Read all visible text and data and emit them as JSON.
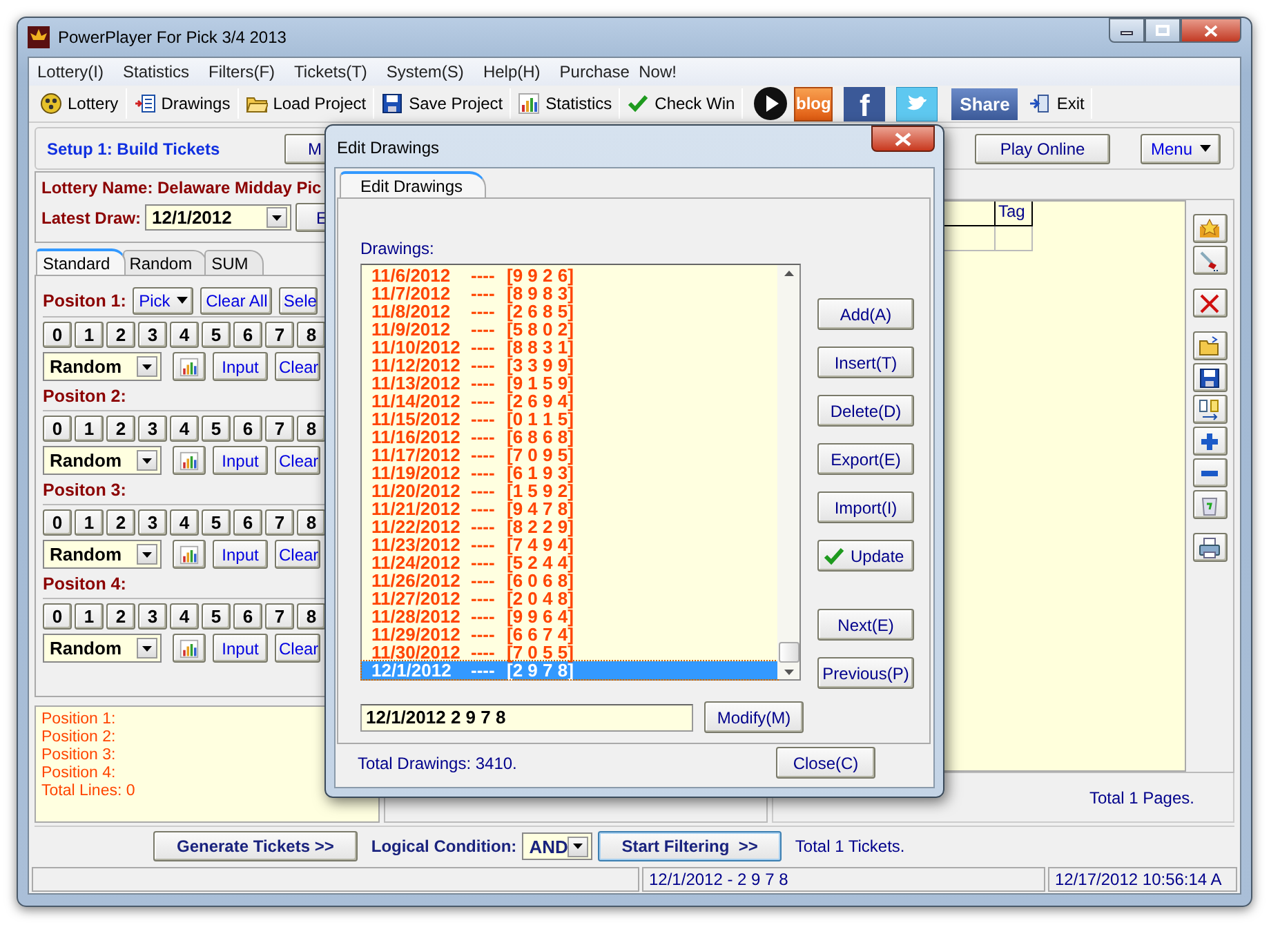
{
  "window": {
    "title": "PowerPlayer For Pick 3/4 2013"
  },
  "menu": [
    "Lottery(I)",
    "Statistics",
    "Filters(F)",
    "Tickets(T)",
    "System(S)",
    "Help(H)",
    "Purchase  Now!"
  ],
  "toolbar": [
    {
      "kind": "tool",
      "label": "Lottery"
    },
    {
      "kind": "tool",
      "label": "Drawings"
    },
    {
      "kind": "tool",
      "label": "Load Project"
    },
    {
      "kind": "tool",
      "label": "Save Project"
    },
    {
      "kind": "tool",
      "label": "Statistics"
    },
    {
      "kind": "tool",
      "label": "Check Win"
    },
    {
      "kind": "play"
    },
    {
      "kind": "blog",
      "label": "blog"
    },
    {
      "kind": "facebook",
      "label": "f"
    },
    {
      "kind": "twitter"
    },
    {
      "kind": "share",
      "label": "Share"
    },
    {
      "kind": "tool",
      "label": "Exit"
    }
  ],
  "setup": {
    "title": "Setup 1: Build  Tickets",
    "cut_button": "M",
    "play_online": "Play Online",
    "menu": "Menu"
  },
  "lottery": {
    "name": "Lottery  Name: Delaware Midday Pic",
    "latest_label": "Latest Draw:",
    "latest_value": "12/1/2012",
    "cut_button": "E"
  },
  "tabs": [
    {
      "label": "Standard",
      "selected": true
    },
    {
      "label": "Random",
      "selected": false
    },
    {
      "label": "SUM",
      "selected": false
    }
  ],
  "position_tools": {
    "pick": "Pick",
    "clear_all": "Clear All",
    "select": "Sele"
  },
  "positions": [
    {
      "title": "Positon 1:",
      "digits": [
        "0",
        "1",
        "2",
        "3",
        "4",
        "5",
        "6",
        "7",
        "8"
      ],
      "mode": "Random",
      "input": "Input",
      "clear": "Clear"
    },
    {
      "title": "Positon 2:",
      "digits": [
        "0",
        "1",
        "2",
        "3",
        "4",
        "5",
        "6",
        "7",
        "8"
      ],
      "mode": "Random",
      "input": "Input",
      "clear": "Clear"
    },
    {
      "title": "Positon 3:",
      "digits": [
        "0",
        "1",
        "2",
        "3",
        "4",
        "5",
        "6",
        "7",
        "8"
      ],
      "mode": "Random",
      "input": "Input",
      "clear": "Clear"
    },
    {
      "title": "Positon 4:",
      "digits": [
        "0",
        "1",
        "2",
        "3",
        "4",
        "5",
        "6",
        "7",
        "8"
      ],
      "mode": "Random",
      "input": "Input",
      "clear": "Clear"
    }
  ],
  "summary": [
    "Position 1:",
    "Position 2:",
    "Position 3:",
    "Position 4:",
    "Total Lines: 0"
  ],
  "grid": {
    "columns": [
      "Tag"
    ]
  },
  "total_pages": "Total 1 Pages.",
  "bottom": {
    "generate": "Generate Tickets >>",
    "logic_label": "Logical Condition:",
    "logic_value": "AND",
    "start": "Start Filtering  >>",
    "total": "Total 1 Tickets."
  },
  "status_bar": {
    "drawing": "12/1/2012 - 2 9 7 8",
    "time": "12/17/2012 10:56:14 A"
  },
  "dialog": {
    "title": "Edit Drawings",
    "tab": "Edit Drawings",
    "list_label": "Drawings:",
    "rows": [
      {
        "date": "11/6/2012",
        "sep": "----",
        "numbers": "[9 9 2 6]",
        "selected": false
      },
      {
        "date": "11/7/2012",
        "sep": "----",
        "numbers": "[8 9 8 3]",
        "selected": false
      },
      {
        "date": "11/8/2012",
        "sep": "----",
        "numbers": "[2 6 8 5]",
        "selected": false
      },
      {
        "date": "11/9/2012",
        "sep": "----",
        "numbers": "[5 8 0 2]",
        "selected": false
      },
      {
        "date": "11/10/2012",
        "sep": "----",
        "numbers": "[8 8 3 1]",
        "selected": false
      },
      {
        "date": "11/12/2012",
        "sep": "----",
        "numbers": "[3 3 9 9]",
        "selected": false
      },
      {
        "date": "11/13/2012",
        "sep": "----",
        "numbers": "[9 1 5 9]",
        "selected": false
      },
      {
        "date": "11/14/2012",
        "sep": "----",
        "numbers": "[2 6 9 4]",
        "selected": false
      },
      {
        "date": "11/15/2012",
        "sep": "----",
        "numbers": "[0 1 1 5]",
        "selected": false
      },
      {
        "date": "11/16/2012",
        "sep": "----",
        "numbers": "[6 8 6 8]",
        "selected": false
      },
      {
        "date": "11/17/2012",
        "sep": "----",
        "numbers": "[7 0 9 5]",
        "selected": false
      },
      {
        "date": "11/19/2012",
        "sep": "----",
        "numbers": "[6 1 9 3]",
        "selected": false
      },
      {
        "date": "11/20/2012",
        "sep": "----",
        "numbers": "[1 5 9 2]",
        "selected": false
      },
      {
        "date": "11/21/2012",
        "sep": "----",
        "numbers": "[9 4 7 8]",
        "selected": false
      },
      {
        "date": "11/22/2012",
        "sep": "----",
        "numbers": "[8 2 2 9]",
        "selected": false
      },
      {
        "date": "11/23/2012",
        "sep": "----",
        "numbers": "[7 4 9 4]",
        "selected": false
      },
      {
        "date": "11/24/2012",
        "sep": "----",
        "numbers": "[5 2 4 4]",
        "selected": false
      },
      {
        "date": "11/26/2012",
        "sep": "----",
        "numbers": "[6 0 6 8]",
        "selected": false
      },
      {
        "date": "11/27/2012",
        "sep": "----",
        "numbers": "[2 0 4 8]",
        "selected": false
      },
      {
        "date": "11/28/2012",
        "sep": "----",
        "numbers": "[9 9 6 4]",
        "selected": false
      },
      {
        "date": "11/29/2012",
        "sep": "----",
        "numbers": "[6 6 7 4]",
        "selected": false
      },
      {
        "date": "11/30/2012",
        "sep": "----",
        "numbers": "[7 0 5 5]",
        "selected": false
      },
      {
        "date": "12/1/2012",
        "sep": "----",
        "numbers": "[2 9 7 8]",
        "selected": true
      }
    ],
    "buttons": [
      {
        "kind": "plain",
        "label": "Add(A)"
      },
      {
        "kind": "plain",
        "label": "Insert(T)"
      },
      {
        "kind": "plain",
        "label": "Delete(D)"
      },
      {
        "kind": "plain",
        "label": "Export(E)"
      },
      {
        "kind": "plain",
        "label": "Import(I)"
      },
      {
        "kind": "check",
        "label": "Update"
      }
    ],
    "nav_buttons": [
      "Next(E)",
      "Previous(P)"
    ],
    "entry": "12/1/2012 2 9 7 8",
    "modify": "Modify(M)",
    "total": "Total Drawings: 3410.",
    "close": "Close(C)"
  }
}
